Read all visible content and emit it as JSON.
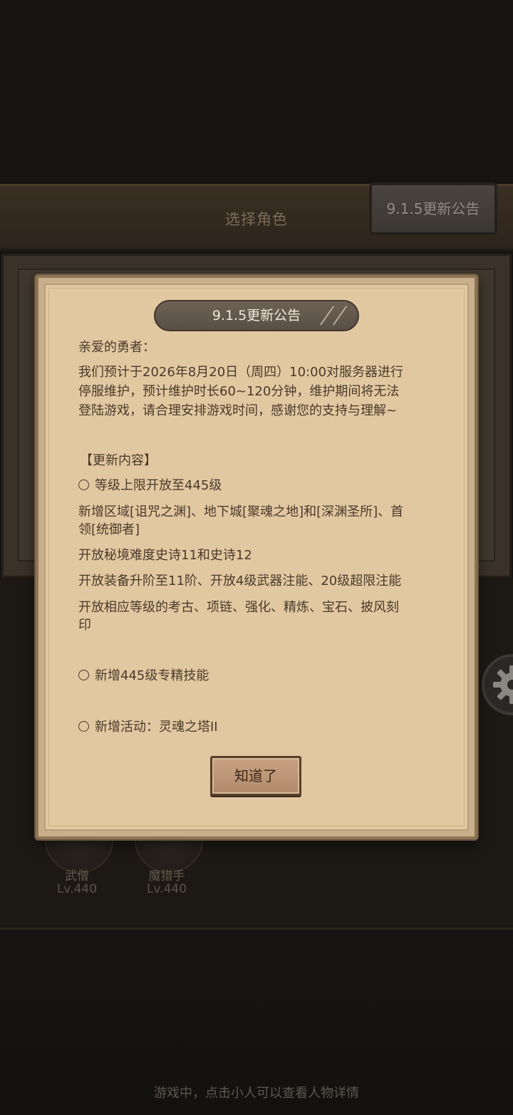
{
  "background": {
    "header_title": "选择角色",
    "notice_tab_label": "9.1.5更新公告",
    "characters": [
      {
        "name": "武僧",
        "level": "Lv.440"
      },
      {
        "name": "魔猎手",
        "level": "Lv.440"
      }
    ],
    "footer_hint": "游戏中，点击小人可以查看人物详情"
  },
  "modal": {
    "title": "9.1.5更新公告",
    "greeting": "亲爱的勇者：",
    "paragraph_lines": [
      "我们预计于2026年8月20日（周四）10:00对服务器进行",
      "停服维护，预计维护时长60~120分钟，维护期间将无法",
      "登陆游戏，请合理安排游戏时间，感谢您的支持与理解~"
    ],
    "section_head": "【更新内容】",
    "items": {
      "item1": "等级上限开放至445级",
      "item1_l1": "新增区域[诅咒之渊]、地下城[聚魂之地]和[深渊圣所]、首",
      "item1_l2": "领[统御者]",
      "item1_l3": "开放秘境难度史诗11和史诗12",
      "item1_l4": "开放装备升阶至11阶、开放4级武器注能、20级超限注能",
      "item1_l5": "开放相应等级的考古、项链、强化、精炼、宝石、披风刻",
      "item1_l6": "印",
      "item2": "新增445级专精技能",
      "item3": "新增活动：灵魂之塔II"
    },
    "ok_button": "知道了"
  },
  "icons": {
    "gear": "gear-icon",
    "bullet": "circle-bullet-icon"
  },
  "colors": {
    "paper": "#e1c8a1",
    "text": "#4a3a2a",
    "title_bar": "#5a4f45"
  }
}
